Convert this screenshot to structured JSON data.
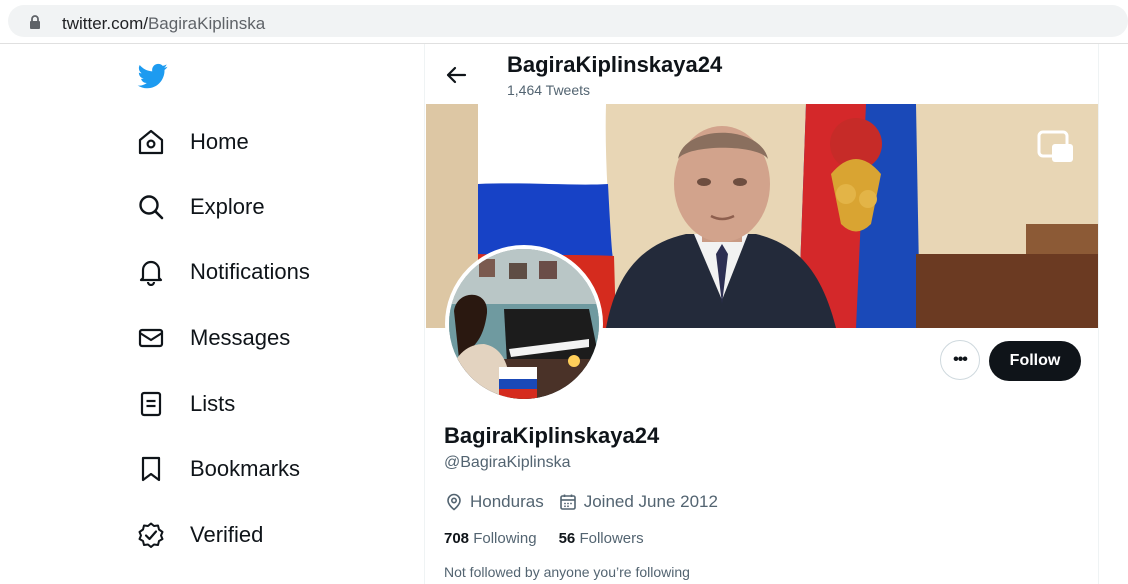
{
  "browser": {
    "url_host": "twitter.com/",
    "url_path": "BagiraKiplinska"
  },
  "sidebar": {
    "logo": "twitter-bird-icon",
    "items": [
      {
        "label": "Home",
        "icon": "home-icon"
      },
      {
        "label": "Explore",
        "icon": "search-icon"
      },
      {
        "label": "Notifications",
        "icon": "bell-icon"
      },
      {
        "label": "Messages",
        "icon": "envelope-icon"
      },
      {
        "label": "Lists",
        "icon": "list-icon"
      },
      {
        "label": "Bookmarks",
        "icon": "bookmark-icon"
      },
      {
        "label": "Verified",
        "icon": "verified-badge-icon"
      }
    ]
  },
  "header": {
    "name": "BagiraKiplinskaya24",
    "tweet_count": "1,464 Tweets"
  },
  "profile": {
    "display_name": "BagiraKiplinskaya24",
    "handle": "@BagiraKiplinska",
    "location": "Honduras",
    "joined": "Joined June 2012",
    "following_count": "708",
    "following_label": "Following",
    "followers_count": "56",
    "followers_label": "Followers",
    "followed_by_note": "Not followed by anyone you’re following",
    "follow_label": "Follow",
    "more_label": "•••"
  },
  "colors": {
    "brand": "#1d9bf0",
    "text": "#0f1419",
    "secondary": "#536471",
    "follow_bg": "#0f1419"
  }
}
